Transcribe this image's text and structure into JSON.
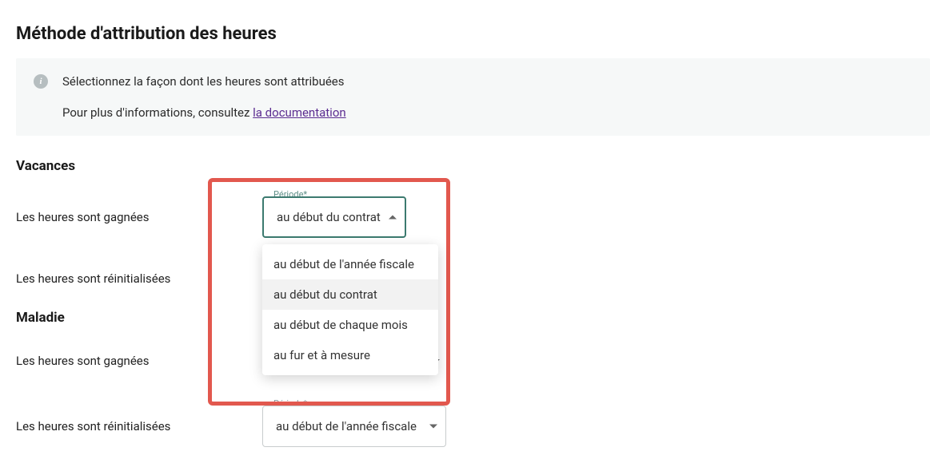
{
  "page": {
    "title": "Méthode d'attribution des heures"
  },
  "info": {
    "line1": "Sélectionnez la façon dont les heures sont attribuées",
    "line2_prefix": "Pour plus d'informations, consultez ",
    "doc_link_text": "la documentation"
  },
  "sections": {
    "vacances": {
      "title": "Vacances",
      "gained_label": "Les heures sont gagnées",
      "reset_label": "Les heures sont réinitialisées"
    },
    "maladie": {
      "title": "Maladie",
      "gained_label": "Les heures sont gagnées",
      "reset_label": "Les heures sont réinitialisées"
    }
  },
  "select": {
    "field_label": "Période*",
    "vac_gained_value": "au début du contrat",
    "maladie_reset_value": "au début de l'année fiscale",
    "options": [
      "au début de l'année fiscale",
      "au début du contrat",
      "au début de chaque mois",
      "au fur et à mesure"
    ]
  }
}
